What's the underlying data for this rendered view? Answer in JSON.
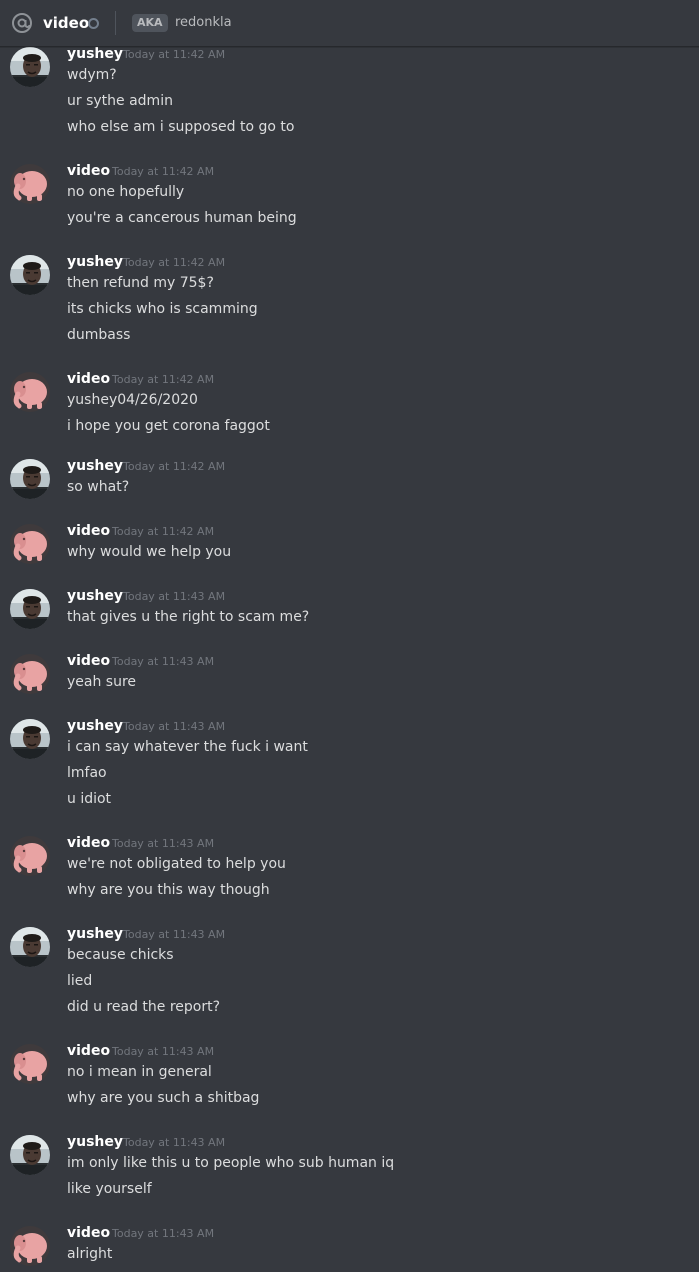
{
  "header": {
    "name": "video",
    "aka_label": "AKA",
    "aka_name": "redonkla"
  },
  "colors": {
    "background": "#36393f",
    "username": "#ffffff",
    "timestamp": "#72767d",
    "text": "#dcddde",
    "elephant_avatar": "#e8a3a3"
  },
  "messages": [
    {
      "author": "yushey",
      "avatar": "photo-avatar",
      "time": "Today at 11:42 AM",
      "lines": [
        "wdym?",
        "ur sythe admin",
        "who else am i supposed to go to"
      ]
    },
    {
      "author": "video",
      "avatar": "elephant-avatar",
      "time": "Today at 11:42 AM",
      "lines": [
        "no one hopefully",
        "you're a cancerous human being"
      ]
    },
    {
      "author": "yushey",
      "avatar": "photo-avatar",
      "time": "Today at 11:42 AM",
      "lines": [
        "then refund my 75$?",
        "its chicks who is scamming",
        "dumbass"
      ]
    },
    {
      "author": "video",
      "avatar": "elephant-avatar",
      "time": "Today at 11:42 AM",
      "lines": [
        "yushey04/26/2020",
        "i hope you get corona faggot"
      ]
    },
    {
      "author": "yushey",
      "avatar": "photo-avatar",
      "time": "Today at 11:42 AM",
      "lines": [
        "so what?"
      ]
    },
    {
      "author": "video",
      "avatar": "elephant-avatar",
      "time": "Today at 11:42 AM",
      "lines": [
        "why would we help you"
      ]
    },
    {
      "author": "yushey",
      "avatar": "photo-avatar",
      "time": "Today at 11:43 AM",
      "lines": [
        "that gives u the right to scam me?"
      ]
    },
    {
      "author": "video",
      "avatar": "elephant-avatar",
      "time": "Today at 11:43 AM",
      "lines": [
        "yeah sure"
      ]
    },
    {
      "author": "yushey",
      "avatar": "photo-avatar",
      "time": "Today at 11:43 AM",
      "lines": [
        "i can say whatever the fuck i want",
        "lmfao",
        "u idiot"
      ]
    },
    {
      "author": "video",
      "avatar": "elephant-avatar",
      "time": "Today at 11:43 AM",
      "lines": [
        "we're not obligated to help you",
        "why are you this way though"
      ]
    },
    {
      "author": "yushey",
      "avatar": "photo-avatar",
      "time": "Today at 11:43 AM",
      "lines": [
        "because chicks",
        "lied",
        "did u read the report?"
      ]
    },
    {
      "author": "video",
      "avatar": "elephant-avatar",
      "time": "Today at 11:43 AM",
      "lines": [
        "no i mean in general",
        "why are you such a shitbag"
      ]
    },
    {
      "author": "yushey",
      "avatar": "photo-avatar",
      "time": "Today at 11:43 AM",
      "lines": [
        "im only like this u to people who sub human iq",
        "like yourself"
      ]
    },
    {
      "author": "video",
      "avatar": "elephant-avatar",
      "time": "Today at 11:43 AM",
      "lines": [
        "alright"
      ]
    }
  ]
}
